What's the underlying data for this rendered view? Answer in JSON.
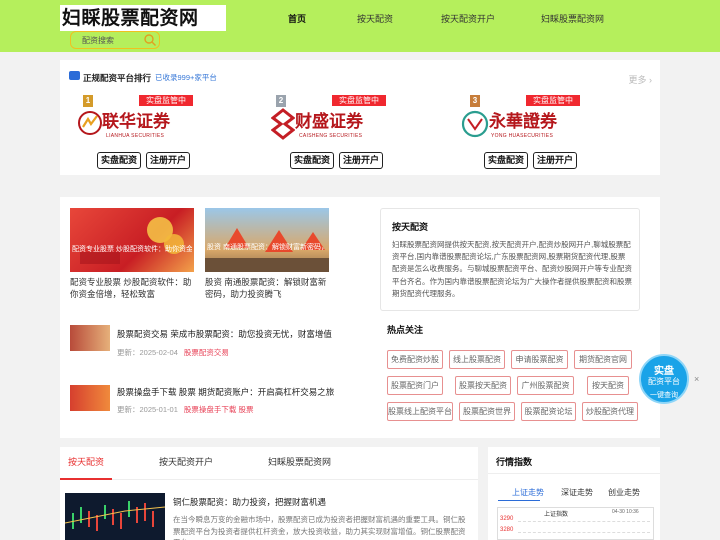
{
  "header": {
    "logo": "妇睬股票配资网",
    "search_placeholder": "配资搜索",
    "nav": [
      "首页",
      "按天配资",
      "按天配资开户",
      "妇睬股票配资网"
    ]
  },
  "ranking": {
    "title": "正规配资平台排行",
    "count": "已收录999+家平台",
    "more": "更多",
    "brokers": [
      {
        "rank": "1",
        "badge": "实盘监管中",
        "name": "联华证券",
        "en": "LIANHUA SECURITIES",
        "btn1": "实盘配资",
        "btn2": "注册开户"
      },
      {
        "rank": "2",
        "badge": "实盘监管中",
        "name": "财盛证券",
        "en": "CAISHENG SECURITIES",
        "btn1": "实盘配资",
        "btn2": "注册开户"
      },
      {
        "rank": "3",
        "badge": "实盘监管中",
        "name": "永華證券",
        "en": "YONG HUASECURITIES",
        "btn1": "实盘配资",
        "btn2": "注册开户"
      }
    ]
  },
  "featured": [
    {
      "caption": "配资专业股票 炒股配资软件：助你资金倍增，轻松致富",
      "title": "配资专业股票 炒股配资软件：助你资金倍增，轻松致富"
    },
    {
      "caption": "股资 南通股票配资：解锁财富新密码，助力投资腾飞",
      "title": "股资 南通股票配资：解锁财富新密码，助力投资腾飞"
    }
  ],
  "list": [
    {
      "title": "股票配资交易 荣成市股票配资：助您投资无忧，财富增值",
      "meta": "更新：2025-02-04",
      "tag": "股票配资交易"
    },
    {
      "title": "股票操盘手下载 股票 期货配资账户：开启高杠杆交易之旅",
      "meta": "更新：2025-01-01",
      "tag": "股票操盘手下载 股票"
    }
  ],
  "about": {
    "title": "按天配资",
    "text": "妇睬股票配资网提供按天配资,按天配资开户,配资炒股网开户,聊城股票配资平台,国内靠谱股票配资论坛,广东股票配资网,股票期货配资代理,股票配资是怎么收费服务。与聊城股票配资平台、配资炒股网开户等专业配资平台齐名。作为国内靠谱股票配资论坛为广大操作者提供股票配资和股票期货配资代理服务。"
  },
  "hot": {
    "title": "热点关注",
    "tags": [
      "免费配资炒股",
      "线上股票配资",
      "申请股票配资",
      "期货配资官网",
      "股票配资门户",
      "股票按天配资",
      "广州股票配资",
      "按天配资",
      "股票线上配资平台",
      "股票配资世界",
      "股票配资论坛",
      "炒股配资代理"
    ]
  },
  "float": {
    "l1": "实盘",
    "l2": "配资平台",
    "l3": "一键查询",
    "close": "×"
  },
  "tabs": {
    "items": [
      "按天配资",
      "按天配资开户",
      "妇睬股票配资网"
    ],
    "article_title": "铜仁股票配资：助力投资，把握财富机遇",
    "article_desc": "在当今瞬息万变的金融市场中，股票配资已成为投资者把握财富机遇的重要工具。铜仁股票配资平台为投资者提供杠杆资金，放大投资收益，助力其实现财富增值。铜仁股票配资平台..."
  },
  "market": {
    "title": "行情指数",
    "tabs": [
      "上证走势",
      "深证走势",
      "创业走势"
    ],
    "chart_name": "上证指数",
    "chart_time": "04-30 10:36",
    "chart_vals": [
      "3290",
      "3280"
    ]
  },
  "colors": {
    "header_bg": "#b5ef5c",
    "accent_red": "#e83030",
    "badge_red": "#f0282f",
    "tag_border": "#e79090",
    "blue": "#2b6cd8"
  }
}
